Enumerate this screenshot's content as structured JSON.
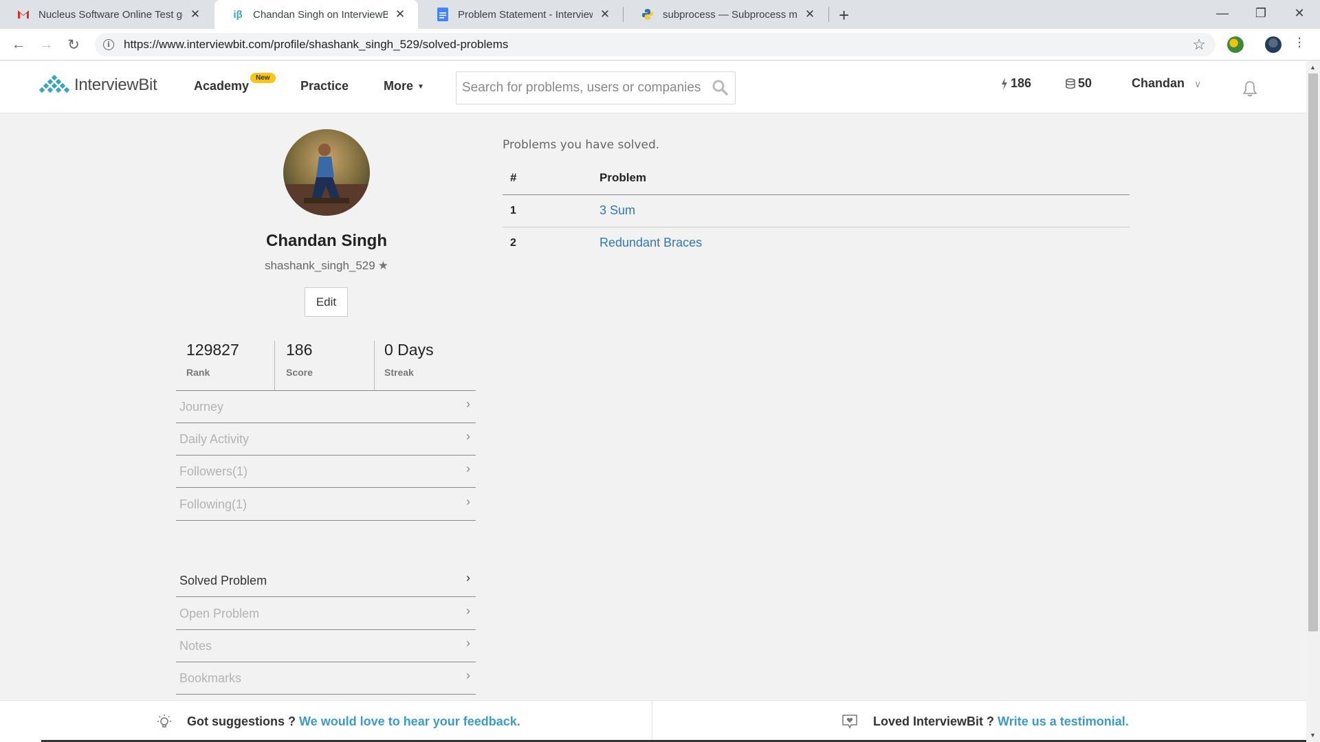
{
  "browser": {
    "tabs": [
      {
        "title": "Nucleus Software Online Test get",
        "icon": "gmail-icon"
      },
      {
        "title": "Chandan Singh on InterviewBit: C",
        "icon": "interviewbit-icon"
      },
      {
        "title": "Problem Statement - Interview - (",
        "icon": "google-docs-icon"
      },
      {
        "title": "subprocess — Subprocess manag",
        "icon": "python-icon"
      }
    ],
    "url": "https://www.interviewbit.com/profile/shashank_singh_529/solved-problems"
  },
  "header": {
    "brand": "InterviewBit",
    "nav": {
      "academy": "Academy",
      "new_badge": "New",
      "practice": "Practice",
      "more": "More"
    },
    "search_placeholder": "Search for problems, users or companies",
    "score": "186",
    "coins": "50",
    "user": "Chandan"
  },
  "profile": {
    "name": "Chandan Singh",
    "handle": "shashank_singh_529",
    "edit_label": "Edit",
    "stats": [
      {
        "value": "129827",
        "label": "Rank"
      },
      {
        "value": "186",
        "label": "Score"
      },
      {
        "value": "0 Days",
        "label": "Streak"
      }
    ],
    "menu_primary": [
      {
        "label": "Journey"
      },
      {
        "label": "Daily Activity"
      },
      {
        "label": "Followers(1)"
      },
      {
        "label": "Following(1)"
      }
    ],
    "menu_secondary": [
      {
        "label": "Solved Problem",
        "active": true
      },
      {
        "label": "Open Problem"
      },
      {
        "label": "Notes"
      },
      {
        "label": "Bookmarks"
      }
    ]
  },
  "main": {
    "caption": "Problems you have solved.",
    "columns": [
      "#",
      "Problem"
    ],
    "rows": [
      {
        "num": "1",
        "problem": "3 Sum"
      },
      {
        "num": "2",
        "problem": "Redundant Braces"
      }
    ]
  },
  "footer": {
    "left_text": "Got suggestions ?",
    "left_link": "We would love to hear your feedback.",
    "right_text": "Loved InterviewBit ?",
    "right_link": "Write us a testimonial."
  },
  "colors": {
    "link": "#2e78b7",
    "footer_link": "#3c9bc4",
    "badge": "#f5c518",
    "brand_teal": "#3aa7b8"
  }
}
